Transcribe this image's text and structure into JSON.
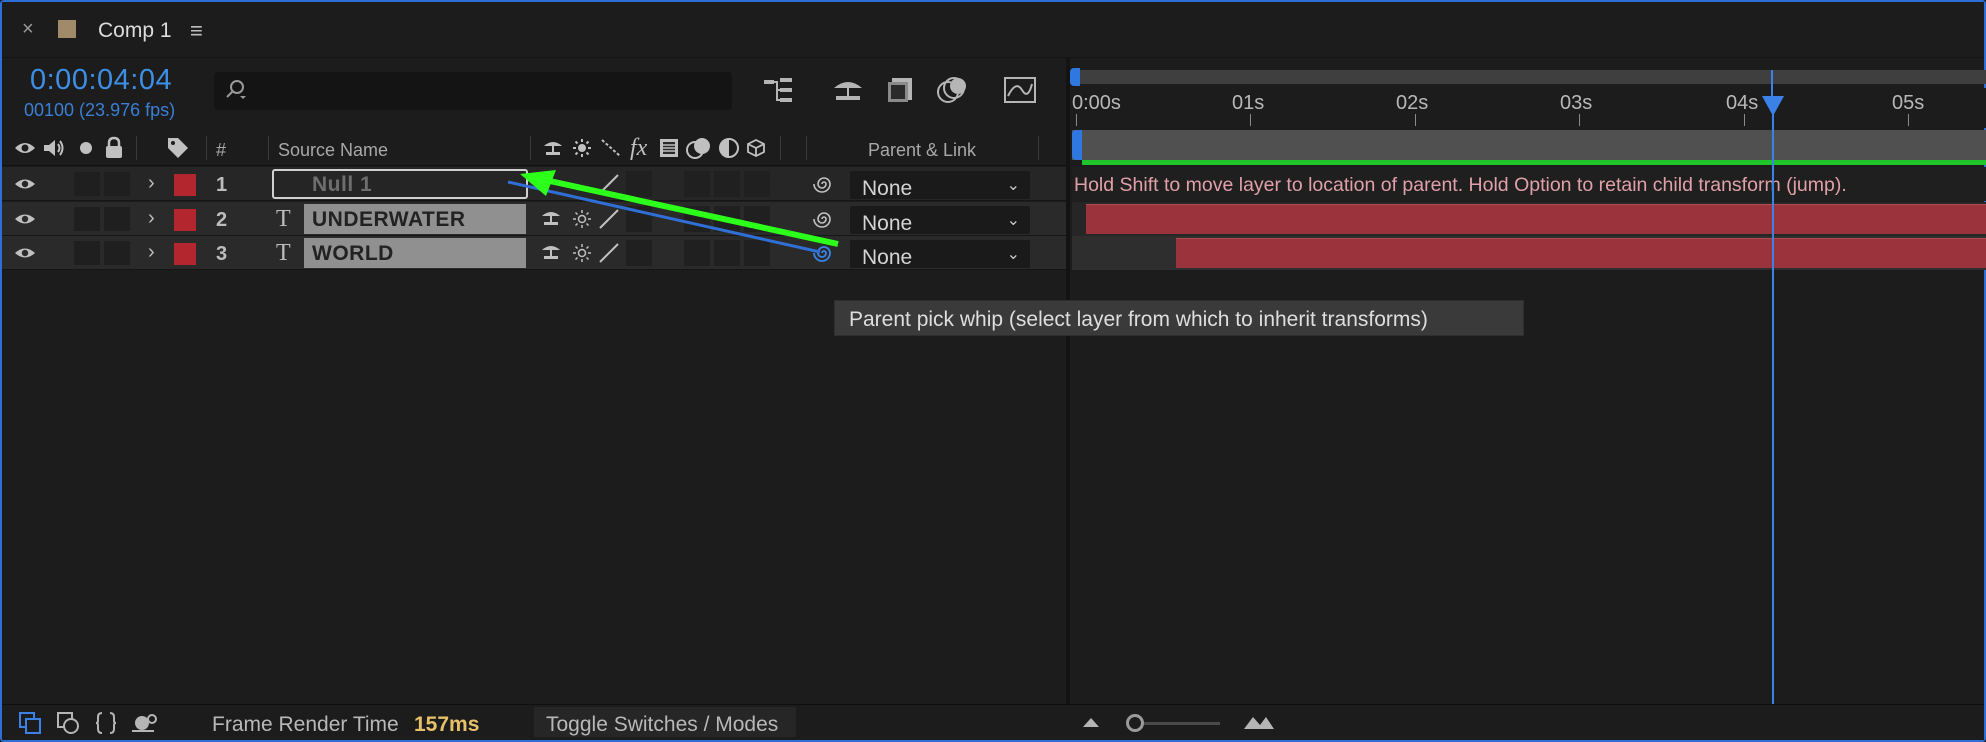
{
  "tab": {
    "close": "×",
    "title": "Comp 1",
    "menu": "≡"
  },
  "time": {
    "timecode": "0:00:04:04",
    "frame_fps": "00100 (23.976 fps)"
  },
  "search": {
    "placeholder": ""
  },
  "columns": {
    "number": "#",
    "source_name": "Source Name",
    "fx": "fx",
    "parent_link": "Parent & Link"
  },
  "layers": [
    {
      "number": "1",
      "type": "null",
      "type_glyph": "",
      "name": "Null 1",
      "parent": "None",
      "label_color": "#b3262d"
    },
    {
      "number": "2",
      "type": "text",
      "type_glyph": "T",
      "name": "UNDERWATER",
      "parent": "None",
      "label_color": "#b3262d"
    },
    {
      "number": "3",
      "type": "text",
      "type_glyph": "T",
      "name": "WORLD",
      "parent": "None",
      "label_color": "#b3262d"
    }
  ],
  "timeline": {
    "ruler_labels": [
      "0:00s",
      "01s",
      "02s",
      "03s",
      "04s",
      "05s"
    ],
    "hint": "Hold Shift to move layer to location of parent. Hold Option to retain child transform (jump)."
  },
  "tooltip": "Parent pick whip (select layer from which to inherit transforms)",
  "bottom": {
    "frame_render_label": "Frame Render Time",
    "frame_render_value": "157ms",
    "toggle_label": "Toggle Switches / Modes"
  },
  "colors": {
    "accent_blue": "#3d8fe6",
    "layer_bar": "#9b333c",
    "green_line": "#1fc52a",
    "whip_arrow": "#2cff1a"
  }
}
